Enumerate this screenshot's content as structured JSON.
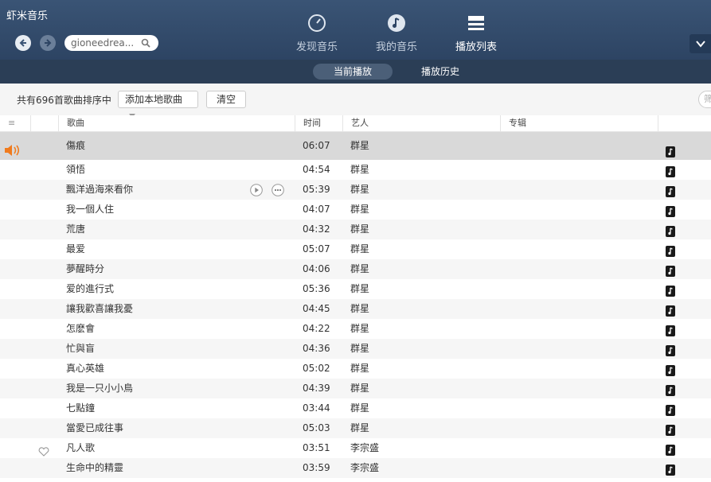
{
  "app": {
    "title": "虾米音乐"
  },
  "search": {
    "value": "gioneedrea..."
  },
  "topnav": {
    "discover": "发现音乐",
    "mine": "我的音乐",
    "playlist": "播放列表"
  },
  "subtabs": {
    "current": "当前播放",
    "history": "播放历史"
  },
  "toolbar": {
    "count_text": "共有696首歌曲排序中",
    "add_local": "添加本地歌曲",
    "clear": "清空",
    "filter_placeholder": "筛"
  },
  "table": {
    "columns": {
      "menu": "≡",
      "song": "歌曲",
      "time": "时间",
      "artist": "艺人",
      "album": "专辑"
    },
    "rows": [
      {
        "name": "傷痕",
        "time": "06:07",
        "artist": "群星"
      },
      {
        "name": "領悟",
        "time": "04:54",
        "artist": "群星"
      },
      {
        "name": "飄洋過海來看你",
        "time": "05:39",
        "artist": "群星"
      },
      {
        "name": "我一個人住",
        "time": "04:07",
        "artist": "群星"
      },
      {
        "name": "荒唐",
        "time": "04:32",
        "artist": "群星"
      },
      {
        "name": "最爱",
        "time": "05:07",
        "artist": "群星"
      },
      {
        "name": "夢醒時分",
        "time": "04:06",
        "artist": "群星"
      },
      {
        "name": "爱的進行式",
        "time": "05:36",
        "artist": "群星"
      },
      {
        "name": "讓我歡喜讓我憂",
        "time": "04:45",
        "artist": "群星"
      },
      {
        "name": "怎麽會",
        "time": "04:22",
        "artist": "群星"
      },
      {
        "name": "忙與盲",
        "time": "04:36",
        "artist": "群星"
      },
      {
        "name": "真心英雄",
        "time": "05:02",
        "artist": "群星"
      },
      {
        "name": "我是一只小小鳥",
        "time": "04:39",
        "artist": "群星"
      },
      {
        "name": "七點鐘",
        "time": "03:44",
        "artist": "群星"
      },
      {
        "name": "當愛已成往事",
        "time": "05:03",
        "artist": "群星"
      },
      {
        "name": "凡人歌",
        "time": "03:51",
        "artist": "李宗盛"
      },
      {
        "name": "生命中的精靈",
        "time": "03:59",
        "artist": "李宗盛"
      }
    ]
  },
  "colors": {
    "header": "#2d4463",
    "accent": "#f07b1e",
    "playing_row": "#d9d9d9"
  },
  "icons": {
    "back": "arrow-left-icon",
    "forward": "arrow-right-icon",
    "search": "search-icon",
    "discover": "compass-icon",
    "mine": "music-note-icon",
    "playlist": "list-icon",
    "speaker": "speaker-icon",
    "file": "music-file-icon",
    "heart": "heart-icon",
    "play": "play-icon",
    "more": "more-icon"
  }
}
